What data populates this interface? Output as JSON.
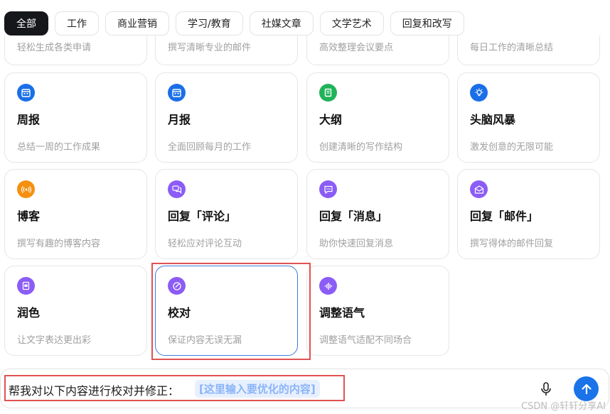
{
  "tabs": [
    {
      "label": "全部",
      "active": true
    },
    {
      "label": "工作"
    },
    {
      "label": "商业营销"
    },
    {
      "label": "学习/教育"
    },
    {
      "label": "社媒文章"
    },
    {
      "label": "文学艺术"
    },
    {
      "label": "回复和改写"
    }
  ],
  "clipped_row": [
    {
      "desc": "轻松生成各类申请"
    },
    {
      "desc": "撰写清晰专业的邮件"
    },
    {
      "desc": "高效整理会议要点"
    },
    {
      "desc": "每日工作的清晰总结"
    }
  ],
  "cards": [
    {
      "title": "周报",
      "desc": "总结一周的工作成果",
      "icon": "calendar-icon",
      "color": "#1a6fe8"
    },
    {
      "title": "月报",
      "desc": "全面回顾每月的工作",
      "icon": "calendar-icon",
      "color": "#1a6fe8"
    },
    {
      "title": "大纲",
      "desc": "创建清晰的写作结构",
      "icon": "notebook-icon",
      "color": "#21b35a"
    },
    {
      "title": "头脑风暴",
      "desc": "激发创意的无限可能",
      "icon": "lightbulb-icon",
      "color": "#1a6fe8"
    },
    {
      "title": "博客",
      "desc": "撰写有趣的博客内容",
      "icon": "broadcast-icon",
      "color": "#f5900f"
    },
    {
      "title": "回复「评论」",
      "desc": "轻松应对评论互动",
      "icon": "comments-icon",
      "color": "#8b5cf6"
    },
    {
      "title": "回复「消息」",
      "desc": "助你快速回复消息",
      "icon": "message-icon",
      "color": "#8b5cf6"
    },
    {
      "title": "回复「邮件」",
      "desc": "撰写得体的邮件回复",
      "icon": "envelope-icon",
      "color": "#8b5cf6"
    },
    {
      "title": "润色",
      "desc": "让文字表达更出彩",
      "icon": "document-icon",
      "color": "#8b5cf6"
    },
    {
      "title": "校对",
      "desc": "保证内容无误无漏",
      "icon": "check-circle-icon",
      "color": "#8b5cf6",
      "selected": true
    },
    {
      "title": "调整语气",
      "desc": "调整语气适配不同场合",
      "icon": "waveform-icon",
      "color": "#8b5cf6"
    }
  ],
  "input": {
    "prompt": "帮我对以下内容进行校对并修正：",
    "slot": "[这里输入要优化的内容]"
  },
  "watermark": "CSDN @轩轩分享AI"
}
